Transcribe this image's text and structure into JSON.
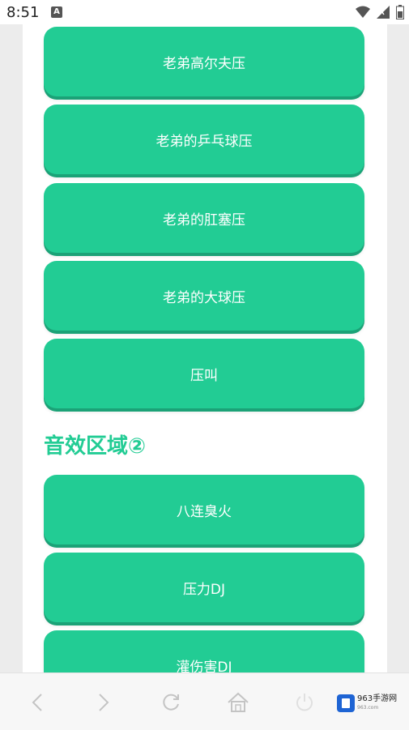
{
  "status_bar": {
    "time": "8:51",
    "notification_letter": "A"
  },
  "sections": {
    "section2_title": "音效区域②"
  },
  "buttons_top": [
    {
      "label": "老弟高尔夫压"
    },
    {
      "label": "老弟的乒乓球压"
    },
    {
      "label": "老弟的肛塞压"
    },
    {
      "label": "老弟的大球压"
    },
    {
      "label": "压叫"
    }
  ],
  "buttons_section2": [
    {
      "label": "八连臭火"
    },
    {
      "label": "压力DJ"
    },
    {
      "label": "灌伤害DJ"
    }
  ],
  "brand": {
    "name": "963手游网",
    "sub": "963.com"
  },
  "colors": {
    "accent": "#22cc94",
    "accent_shadow": "#1ba277"
  }
}
